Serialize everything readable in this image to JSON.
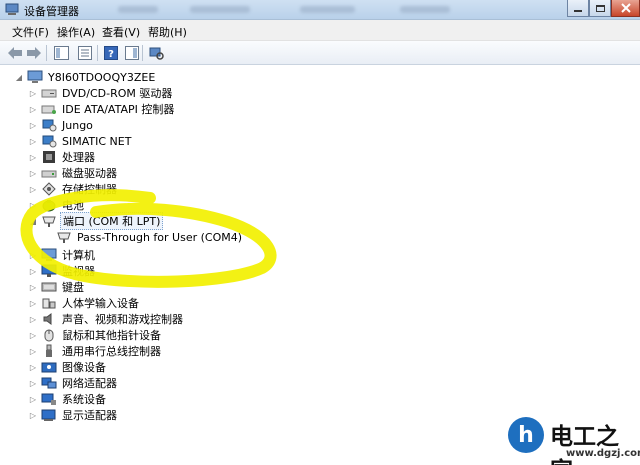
{
  "window": {
    "title": "设备管理器"
  },
  "menubar": [
    {
      "label": "文件(F)"
    },
    {
      "label": "操作(A)"
    },
    {
      "label": "查看(V)"
    },
    {
      "label": "帮助(H)"
    }
  ],
  "toolbar": [
    "back-arrow-icon",
    "forward-arrow-icon",
    "properties-panel-icon",
    "device-list-icon",
    "help-icon",
    "action-panel-icon",
    "scan-hardware-icon"
  ],
  "tree": {
    "root": "Y8I60TDOOQY3ZEE",
    "items": [
      {
        "label": "DVD/CD-ROM 驱动器",
        "icon": "dvd-drive-icon",
        "expanded": false
      },
      {
        "label": "IDE ATA/ATAPI 控制器",
        "icon": "ide-controller-icon",
        "expanded": false
      },
      {
        "label": "Jungo",
        "icon": "jungo-device-icon",
        "expanded": false
      },
      {
        "label": "SIMATIC NET",
        "icon": "simatic-net-icon",
        "expanded": false
      },
      {
        "label": "处理器",
        "icon": "processor-icon",
        "expanded": false
      },
      {
        "label": "磁盘驱动器",
        "icon": "disk-drive-icon",
        "expanded": false
      },
      {
        "label": "存储控制器",
        "icon": "storage-controller-icon",
        "expanded": false
      },
      {
        "label": "电池",
        "icon": "battery-icon",
        "expanded": false
      },
      {
        "label": "端口 (COM 和 LPT)",
        "icon": "port-icon",
        "expanded": true,
        "selected": true,
        "children": [
          {
            "label": "Pass-Through for User (COM4)",
            "icon": "port-icon"
          }
        ]
      },
      {
        "label": "计算机",
        "icon": "computer-icon",
        "expanded": false
      },
      {
        "label": "监视器",
        "icon": "monitor-icon",
        "expanded": false
      },
      {
        "label": "键盘",
        "icon": "keyboard-icon",
        "expanded": false
      },
      {
        "label": "人体学输入设备",
        "icon": "hid-icon",
        "expanded": false
      },
      {
        "label": "声音、视频和游戏控制器",
        "icon": "sound-icon",
        "expanded": false
      },
      {
        "label": "鼠标和其他指针设备",
        "icon": "mouse-icon",
        "expanded": false
      },
      {
        "label": "通用串行总线控制器",
        "icon": "usb-icon",
        "expanded": false
      },
      {
        "label": "图像设备",
        "icon": "imaging-icon",
        "expanded": false
      },
      {
        "label": "网络适配器",
        "icon": "network-adapter-icon",
        "expanded": false
      },
      {
        "label": "系统设备",
        "icon": "system-device-icon",
        "expanded": false
      },
      {
        "label": "显示适配器",
        "icon": "display-adapter-icon",
        "expanded": false
      }
    ]
  },
  "watermark": {
    "logo_text": "h",
    "title": "电工之家",
    "url": "www.dgzj.com"
  },
  "colors": {
    "highlight": "#f2f000",
    "title_bar": "#c4d8ee",
    "selection_border": "#7da2ce"
  }
}
